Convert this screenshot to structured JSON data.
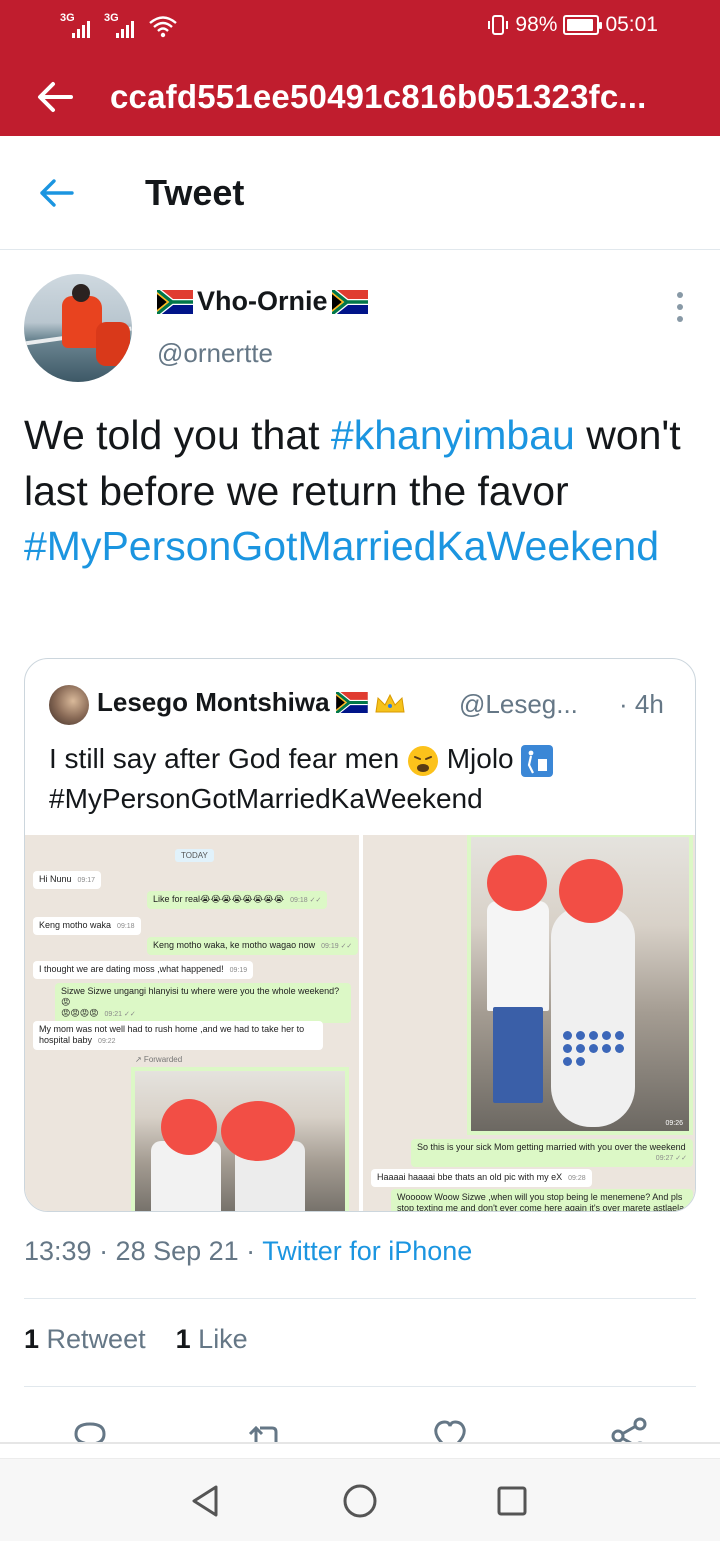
{
  "status_bar": {
    "signal1_label": "3G",
    "signal2_label": "3G",
    "battery": "98%",
    "time": "05:01"
  },
  "app_bar": {
    "title": "ccafd551ee50491c816b051323fc..."
  },
  "tweet_header": {
    "title": "Tweet"
  },
  "tweet": {
    "author_name": "Vho-Ornie",
    "author_handle": "@ornertte",
    "text_plain_1": "We told you that ",
    "hashtag_1": "#khanyimbau",
    "text_plain_2": " won't last before we return the favor ",
    "hashtag_2": "#MyPersonGotMarriedKaWeekend",
    "timestamp": "13:39 · 28 Sep 21 · ",
    "source": "Twitter for iPhone",
    "retweets_count": "1",
    "retweets_label": "Retweet",
    "likes_count": "1",
    "likes_label": "Like"
  },
  "quoted_tweet": {
    "author_name": "Lesego Montshiwa",
    "author_handle": "@Leseg...",
    "time": "· 4h",
    "text_1": "I still say after God fear men",
    "text_2": "Mjolo",
    "hashtag": "#MyPersonGotMarriedKaWeekend"
  },
  "chat_left": {
    "today": "TODAY",
    "m1": "Hi Nunu",
    "m1_t": "09:17",
    "m2": "Like for real😭😭😭😭😭😭😭😭",
    "m2_t": "09:18 ✓✓",
    "m3": "Keng motho waka",
    "m3_t": "09:18",
    "m4": "Keng motho waka,  ke motho wagao now",
    "m4_t": "09:19 ✓✓",
    "m5": "I thought we are dating moss ,what happened!",
    "m5_t": "09:19",
    "m6": "Sizwe  Sizwe ungangi hlanyisi tu where were you the whole weekend?😡",
    "m6b": "😡😡😡😡",
    "m6_t": "09:21 ✓✓",
    "m7": "My mom was not well had to rush home ,and we had to take her to",
    "m7b": "hospital baby",
    "m7_t": "09:22",
    "fwd": "↗ Forwarded"
  },
  "chat_right": {
    "r1": "So this is your sick Mom getting  married with you over the weekend",
    "r1_t": "09:27 ✓✓",
    "r2": "Haaaai haaaai bbe thats an old pic with my eX",
    "r2_t": "09:28",
    "r3": "Woooow Woow Sizwe ,when will you stop being le menemene? And pls",
    "r3b": "stop texting  me and don't ever come here again it's  over marete astlaela",
    "photo_time": "09:26"
  },
  "colors": {
    "app_bar": "#c01d2e",
    "link_blue": "#1b95e0",
    "muted_text": "#657786"
  },
  "icons": [
    "back-arrow-icon",
    "more-vertical-icon",
    "reply-icon",
    "retweet-icon",
    "like-icon",
    "share-icon",
    "nav-back-icon",
    "nav-home-icon",
    "nav-recents-icon"
  ]
}
